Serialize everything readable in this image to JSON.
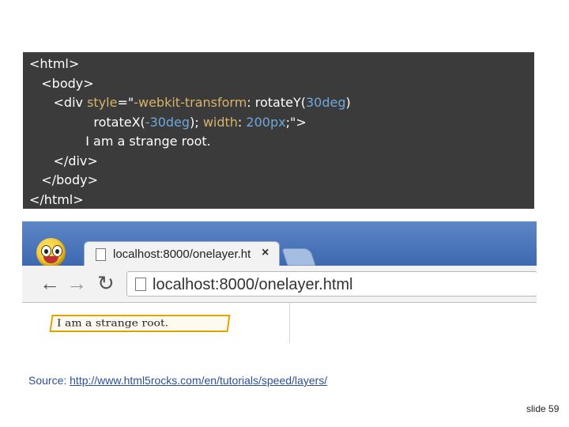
{
  "code": {
    "line1": "<html>",
    "line2": "<body>",
    "line3_pre": "<div ",
    "line3_attr": "style",
    "line3_eq": "=\"",
    "line3_prop": "-webkit-transform",
    "line3_colon": ": rotateY(",
    "line3_num": "30deg",
    "line3_close": ")",
    "line4_func": "rotateX(",
    "line4_num": "-30deg",
    "line4_mid": "); ",
    "line4_prop": "width",
    "line4_colon": ": ",
    "line4_val": "200px",
    "line4_end": ";\">",
    "line5": "I am a strange root.",
    "line6": "</div>",
    "line7": "</body>",
    "line8": "</html>",
    "colors": {
      "background": "#3b3b3b",
      "keyword": "#d8b36a",
      "number": "#6fa8dc"
    }
  },
  "browser": {
    "tab_title": "localhost:8000/onelayer.ht",
    "tab_close": "×",
    "url": "localhost:8000/onelayer.html",
    "back_icon": "←",
    "forward_icon": "→",
    "reload_icon": "↻",
    "content_text": "I am a strange root."
  },
  "footer": {
    "source_label": "Source:",
    "source_link": "http://www.html5rocks.com/en/tutorials/speed/layers/",
    "slide_number": "slide 59"
  }
}
